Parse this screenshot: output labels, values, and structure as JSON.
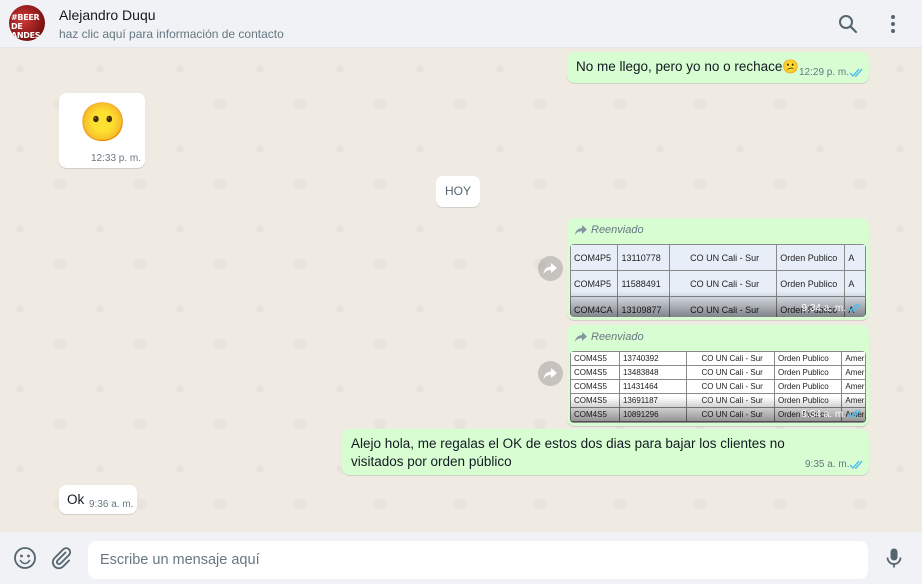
{
  "header": {
    "avatar_text": "#BEER DE ANDES",
    "contact_name": "Alejandro Duqu",
    "contact_subtitle": "haz clic aquí para información de contacto",
    "search_icon": "search-icon",
    "menu_icon": "kebab-menu-icon"
  },
  "messages": [
    {
      "direction": "out",
      "text": "No me llego, pero yo no o rechace😕",
      "time": "12:29 p. m.",
      "status": "read"
    },
    {
      "direction": "in",
      "emoji": "😶",
      "time": "12:33 p. m."
    },
    {
      "type": "system",
      "text": "HOY"
    },
    {
      "direction": "out",
      "forwarded_label": "Reenviado",
      "type": "image",
      "time": "9:34 a. m.",
      "status": "read",
      "table_rows": [
        [
          "COM4P5",
          "13110778",
          "CO UN Cali - Sur",
          "Orden Publico",
          "A"
        ],
        [
          "COM4P5",
          "11588491",
          "CO UN Cali - Sur",
          "Orden Publico",
          "A"
        ],
        [
          "COM4CA",
          "13109877",
          "CO UN Cali - Sur",
          "Orden Publico",
          "A"
        ]
      ]
    },
    {
      "direction": "out",
      "forwarded_label": "Reenviado",
      "type": "image",
      "time": "9:34 a. m.",
      "status": "read",
      "table_rows": [
        [
          "COM4S5",
          "13740392",
          "CO UN Cali - Sur",
          "Orden Publico",
          "Amer"
        ],
        [
          "COM4S5",
          "13483848",
          "CO UN Cali - Sur",
          "Orden Publico",
          "Amer"
        ],
        [
          "COM4S5",
          "11431464",
          "CO UN Cali - Sur",
          "Orden Publico",
          "Amer"
        ],
        [
          "COM4S5",
          "13691187",
          "CO UN Cali - Sur",
          "Orden Publico",
          "Amer"
        ],
        [
          "COM4S5",
          "10891296",
          "CO UN Cali - Sur",
          "Orden Publico",
          "Amer"
        ]
      ]
    },
    {
      "direction": "out",
      "text": "Alejo hola, me regalas el OK de estos dos dias para bajar los clientes no visitados por orden público",
      "time": "9:35 a. m.",
      "status": "read"
    },
    {
      "direction": "in",
      "text": "Ok",
      "time": "9:36 a. m."
    }
  ],
  "footer": {
    "emoji_icon": "emoji-icon",
    "attach_icon": "paperclip-icon",
    "input_placeholder": "Escribe un mensaje aquí",
    "mic_icon": "microphone-icon"
  },
  "colors": {
    "chat_background": "#efeae2",
    "outgoing_bubble": "#d9fdd3",
    "incoming_bubble": "#ffffff",
    "read_ticks": "#53bdeb",
    "header_background": "#f0f2f5"
  }
}
